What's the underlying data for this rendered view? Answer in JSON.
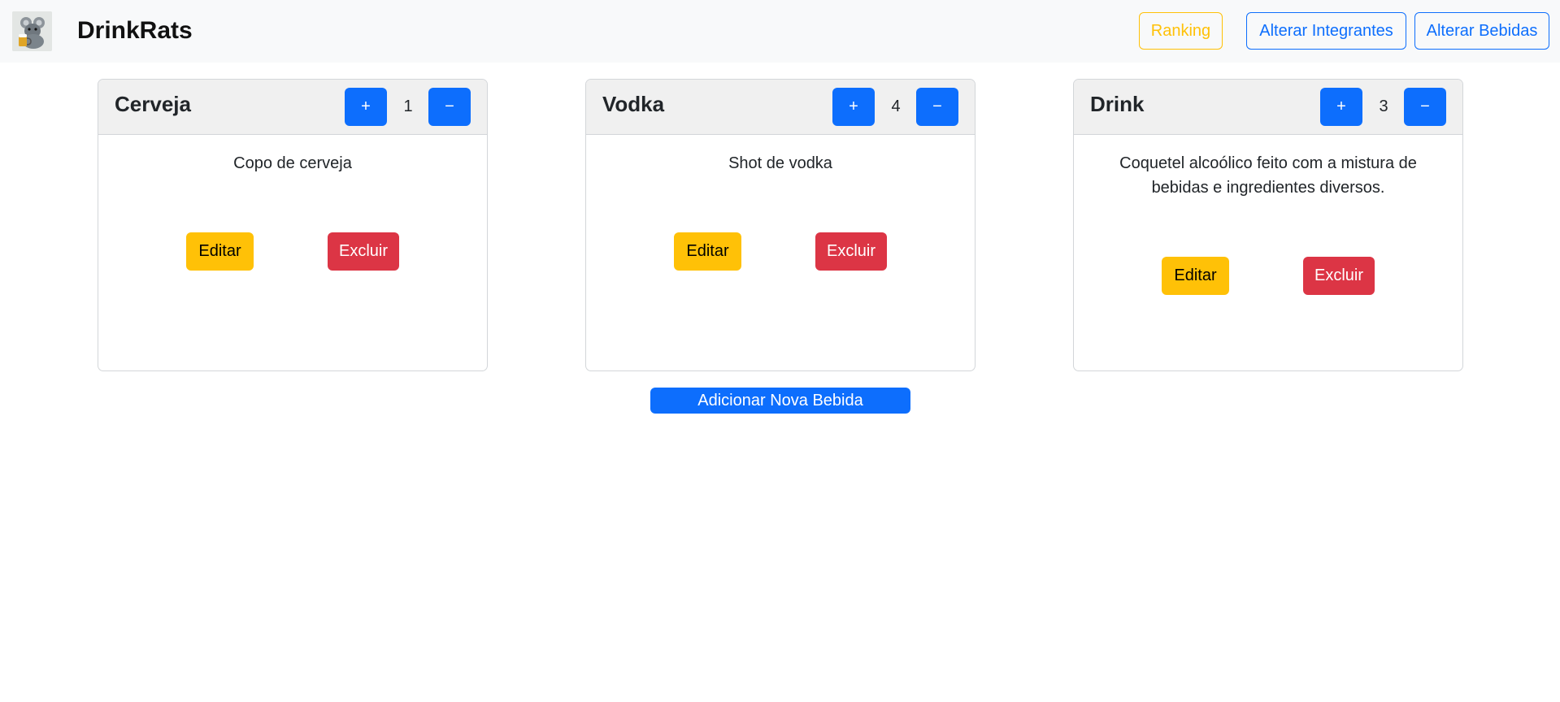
{
  "app": {
    "brand": "DrinkRats",
    "logo_icon": "rat-with-beer-logo-icon"
  },
  "nav": {
    "ranking": "Ranking",
    "alterar_integrantes": "Alterar Integrantes",
    "alterar_bebidas": "Alterar Bebidas"
  },
  "colors": {
    "primary": "#0d6efd",
    "warning": "#ffc107",
    "danger": "#dc3545",
    "navbar_bg": "#f8f9fa",
    "card_header_bg": "#f0f0f0"
  },
  "drinks": [
    {
      "name": "Cerveja",
      "plus": "+",
      "count": "1",
      "minus": "−",
      "description": "Copo de cerveja",
      "edit": "Editar",
      "delete": "Excluir"
    },
    {
      "name": "Vodka",
      "plus": "+",
      "count": "4",
      "minus": "−",
      "description": "Shot de vodka",
      "edit": "Editar",
      "delete": "Excluir"
    },
    {
      "name": "Drink",
      "plus": "+",
      "count": "3",
      "minus": "−",
      "description": "Coquetel alcoólico feito com a mistura de bebidas e ingredientes diversos.",
      "edit": "Editar",
      "delete": "Excluir"
    }
  ],
  "add_drink": "Adicionar Nova Bebida"
}
